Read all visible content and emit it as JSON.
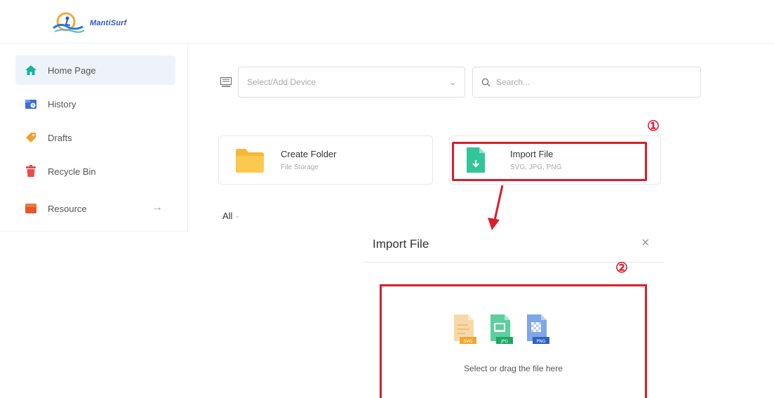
{
  "logo": {
    "text": "MantiSurf"
  },
  "sidebar": {
    "items": [
      {
        "label": "Home Page",
        "icon": "home-icon",
        "active": true,
        "color": "#19b39b"
      },
      {
        "label": "History",
        "icon": "history-icon",
        "color": "#3c6fd6"
      },
      {
        "label": "Drafts",
        "icon": "drafts-icon",
        "color": "#f0a030"
      },
      {
        "label": "Recycle Bin",
        "icon": "recycle-bin-icon",
        "color": "#ec4a4a"
      },
      {
        "label": "Resource",
        "icon": "resource-icon",
        "color": "#e8552a",
        "arrow": "→"
      }
    ]
  },
  "toolbar": {
    "device_placeholder": "Select/Add Device",
    "search_placeholder": "Search..."
  },
  "cards": [
    {
      "title": "Create Folder",
      "subtitle": "File Storage",
      "icon": "folder-icon"
    },
    {
      "title": "Import File",
      "subtitle": "SVG, JPG, PNG",
      "icon": "import-file-icon"
    }
  ],
  "filter": {
    "label": "All"
  },
  "annotations": {
    "step1": "①",
    "step2": "②",
    "color": "#d81e2c"
  },
  "dialog": {
    "title": "Import File",
    "close": "×",
    "drop_text": "Select or drag the file here",
    "file_types": [
      "SVG",
      "JPG",
      "PNG"
    ]
  }
}
